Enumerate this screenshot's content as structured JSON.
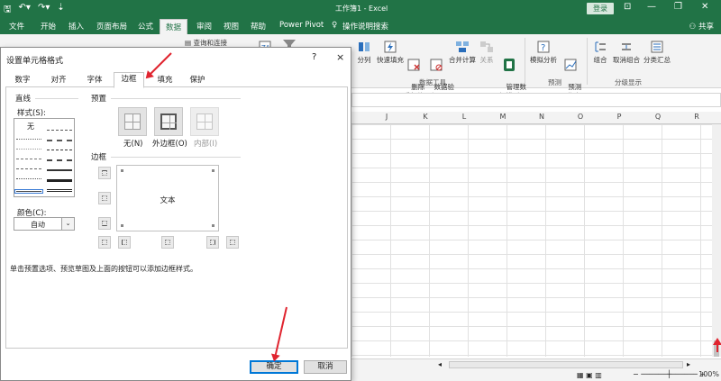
{
  "window": {
    "title": "工作簿1  -  Excel",
    "login": "登录"
  },
  "ribbon_tabs": [
    "文件",
    "开始",
    "插入",
    "页面布局",
    "公式",
    "数据",
    "审阅",
    "视图",
    "帮助",
    "Power Pivot"
  ],
  "active_tab": "数据",
  "tell_me": "操作说明搜索",
  "share": "共享",
  "ribbon": {
    "query_btn": "查询和连接",
    "split": "分列",
    "flash_fill": "快速填充",
    "remove_dup": "删除\n重复值",
    "validate": "数据验\n证·",
    "consolidate": "合并计算",
    "relations": "关系",
    "manage_model": "管理数\n据模型",
    "whatif": "模拟分析",
    "forecast": "预测\n工作表",
    "group": "组合",
    "ungroup": "取消组合",
    "subtotal": "分类汇总",
    "group_data_tools": "数据工具",
    "group_forecast": "预测",
    "group_outline": "分级显示"
  },
  "columns": [
    "J",
    "K",
    "L",
    "M",
    "N",
    "O",
    "P",
    "Q",
    "R"
  ],
  "zoom": "100%",
  "dialog": {
    "title": "设置单元格格式",
    "help": "?",
    "close": "×",
    "tabs": [
      "数字",
      "对齐",
      "字体",
      "边框",
      "填充",
      "保护"
    ],
    "active_tab": "边框",
    "line_section": "直线",
    "style_label": "样式(S):",
    "style_none": "无",
    "color_label": "颜色(C):",
    "color_value": "自动",
    "preset_section": "预置",
    "preset_none": "无(N)",
    "preset_outline": "外边框(O)",
    "preset_inside": "内部(I)",
    "border_section": "边框",
    "preview_text": "文本",
    "hint": "单击预置选项、预览草图及上面的按钮可以添加边框样式。",
    "ok": "确定",
    "cancel": "取消"
  },
  "colors": {
    "excel_green": "#217346",
    "arrow_red": "#e0242f",
    "ok_border": "#0078d7"
  }
}
